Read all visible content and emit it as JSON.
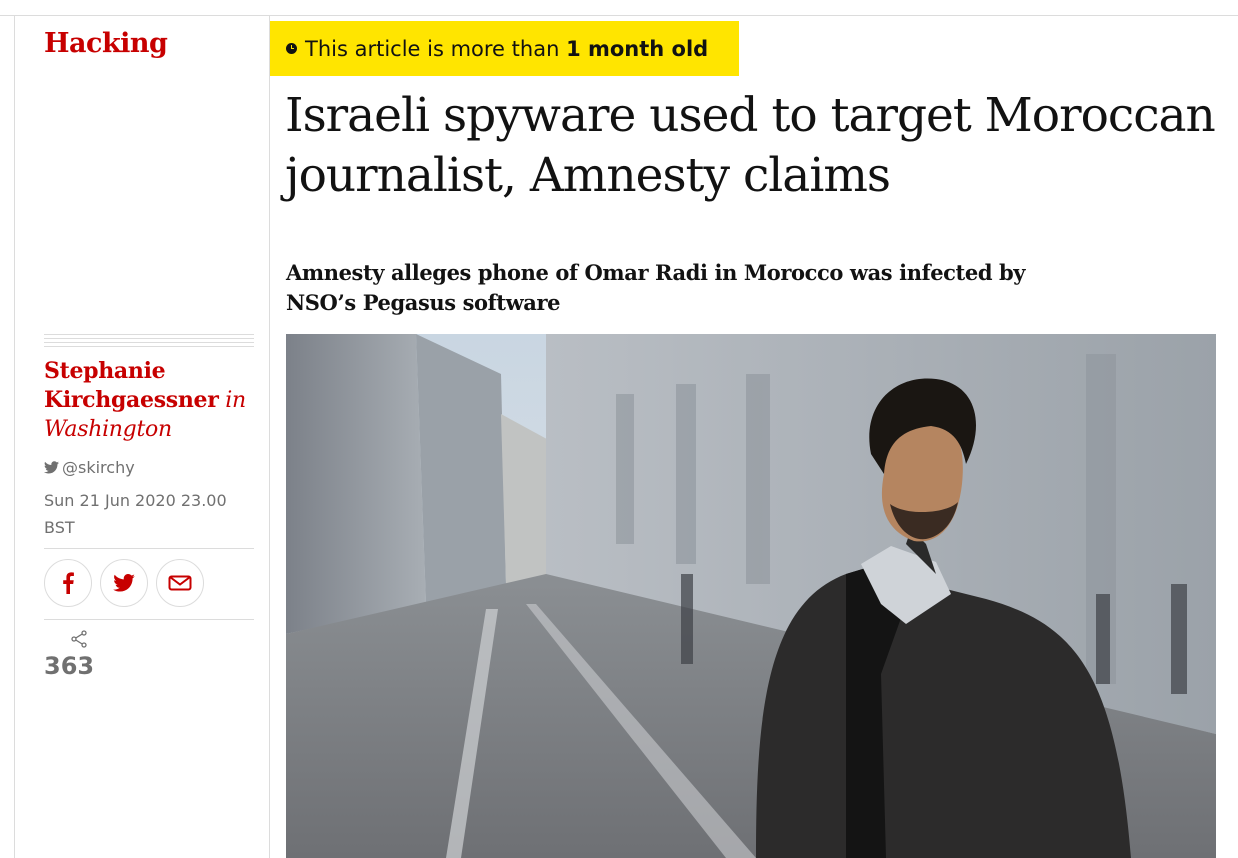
{
  "section": {
    "label": "Hacking"
  },
  "age_notice": {
    "prefix": "This article is more than",
    "age": "1 month old"
  },
  "article": {
    "headline_line1": "Israeli spyware used to target Moroccan",
    "headline_line2": "journalist, Amnesty claims",
    "standfirst_line1": "Amnesty alleges phone of Omar Radi in Morocco was infected by",
    "standfirst_line2": "NSO’s Pegasus software"
  },
  "byline": {
    "author_line1": "Stephanie",
    "author_line2": "Kirchgaessner",
    "in": "in",
    "location": "Washington",
    "twitter": "@skirchy",
    "date_line1": "Sun 21 Jun 2020 23.00",
    "date_line2": "BST"
  },
  "share": {
    "count": "363"
  },
  "colors": {
    "accent": "#c70000",
    "badge": "#ffe500",
    "meta": "#707070"
  }
}
